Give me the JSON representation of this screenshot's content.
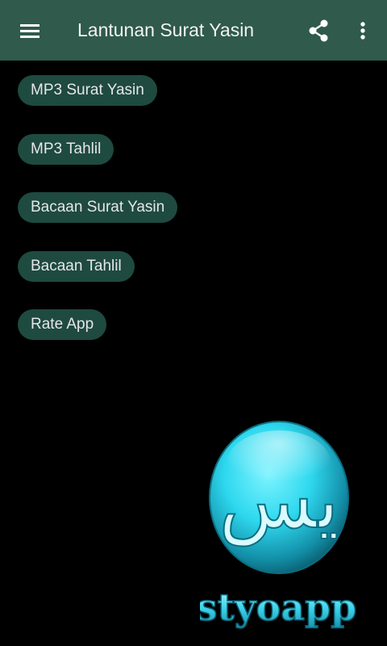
{
  "app_bar": {
    "title": "Lantunan Surat Yasin",
    "icons": {
      "menu": "hamburger-menu-icon",
      "share": "share-icon",
      "more": "more-vert-icon"
    }
  },
  "menu": {
    "items": [
      {
        "label": "MP3 Surat Yasin"
      },
      {
        "label": "MP3 Tahlil"
      },
      {
        "label": "Bacaan Surat Yasin"
      },
      {
        "label": "Bacaan Tahlil"
      },
      {
        "label": "Rate App"
      }
    ]
  },
  "logo": {
    "arabic_text": "يس",
    "brand_text": "styoapp"
  },
  "colors": {
    "toolbar": "#2f5a4c",
    "background": "#000000",
    "button": "#1e4a40",
    "logo_cyan": "#2ed8ee"
  }
}
